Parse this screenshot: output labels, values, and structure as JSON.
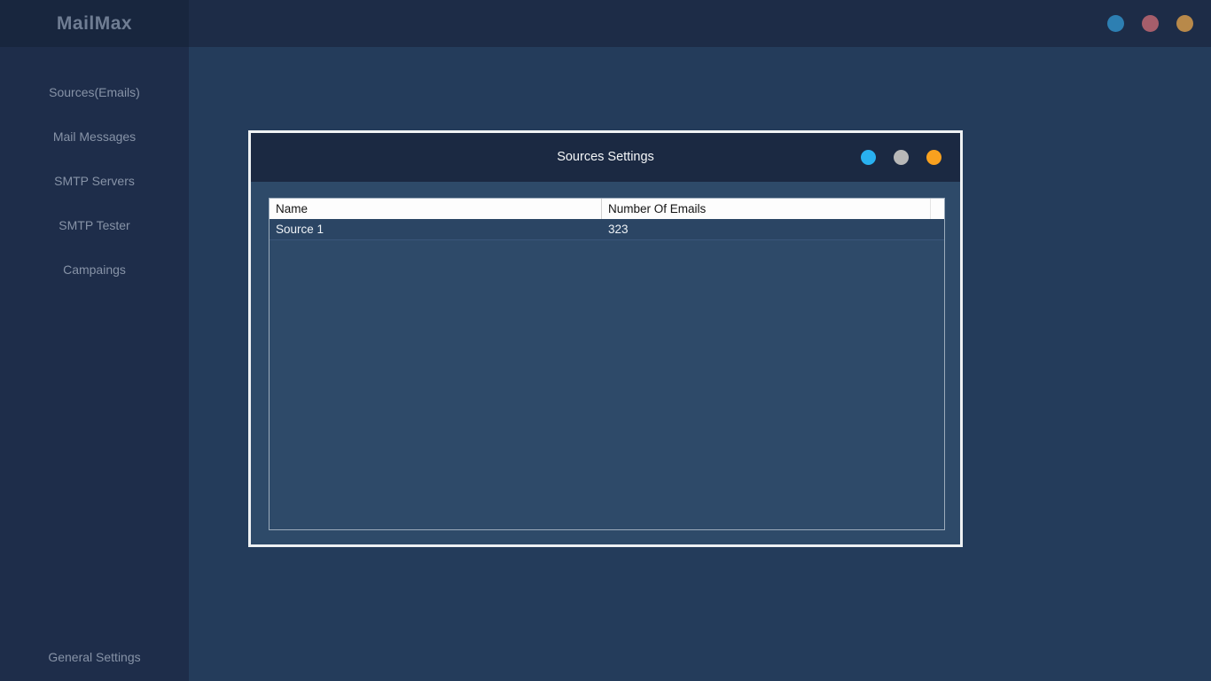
{
  "app": {
    "title": "MailMax"
  },
  "topbar": {
    "controls": [
      {
        "name": "blue",
        "color": "#2d7fb2"
      },
      {
        "name": "red",
        "color": "#a65e6b"
      },
      {
        "name": "orange",
        "color": "#b8894a"
      }
    ]
  },
  "sidebar": {
    "items": [
      {
        "label": "Sources(Emails)"
      },
      {
        "label": "Mail Messages"
      },
      {
        "label": "SMTP Servers"
      },
      {
        "label": "SMTP Tester"
      },
      {
        "label": "Campaings"
      }
    ],
    "bottom_item": {
      "label": "General Settings"
    }
  },
  "dialog": {
    "title": "Sources Settings",
    "controls": [
      {
        "name": "blue",
        "color": "#29b1f0"
      },
      {
        "name": "gray",
        "color": "#b8b8b8"
      },
      {
        "name": "orange",
        "color": "#f9a11f"
      }
    ],
    "table": {
      "columns": [
        "Name",
        "Number Of Emails"
      ],
      "rows": [
        {
          "name": "Source 1",
          "emails": "323"
        }
      ]
    }
  },
  "colors": {
    "topbar_bg": "#1d2c47",
    "logo_area_bg": "#18263e",
    "sidebar_bg": "#1e2d4a",
    "main_bg": "#243c5b",
    "dialog_bg": "#2e4a69",
    "dialog_titlebar_bg": "#1b2942",
    "dialog_border": "#eef1f3",
    "table_border": "#9cacbc",
    "table_header_bg": "#fdfdfd",
    "row_bg": "#2b4564"
  }
}
